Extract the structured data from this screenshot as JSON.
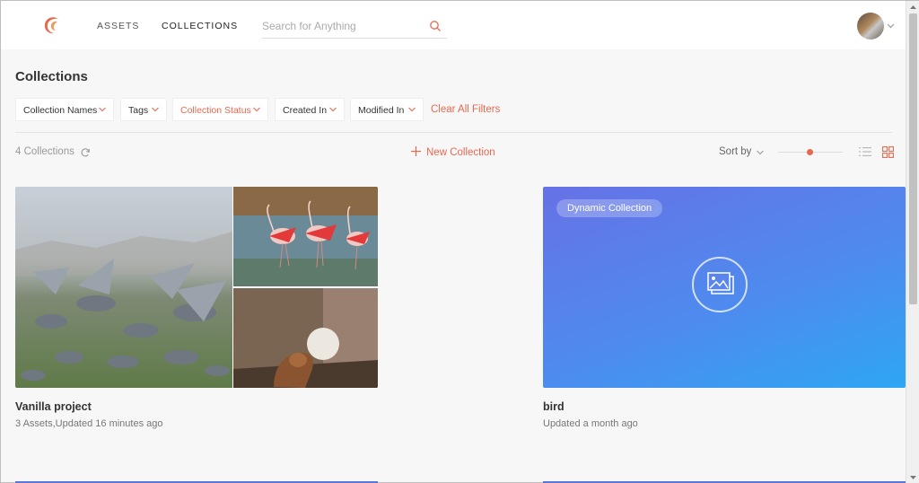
{
  "nav": {
    "assets": "ASSETS",
    "collections": "COLLECTIONS",
    "search_placeholder": "Search for Anything"
  },
  "page": {
    "title": "Collections",
    "filters": [
      {
        "label": "Collection Names"
      },
      {
        "label": "Tags"
      },
      {
        "label": "Collection Status"
      },
      {
        "label": "Created In"
      },
      {
        "label": "Modified In"
      }
    ],
    "clear_filters": "Clear All Filters",
    "count": "4 Collections",
    "new_collection": "New Collection",
    "sort_by": "Sort by"
  },
  "collections": [
    {
      "title": "Vanilla project",
      "subtitle": "3 Assets,Updated 16 minutes ago"
    },
    {
      "title": "bird",
      "subtitle": "Updated a month ago",
      "badge": "Dynamic Collection"
    }
  ],
  "colors": {
    "accent": "#e8684f",
    "card_gradient_start": "#6672e6",
    "card_gradient_end": "#2ea6f3"
  },
  "icons": {
    "logo": "brand-logo-icon",
    "search": "search-icon",
    "refresh": "refresh-icon",
    "plus": "plus-icon",
    "list_view": "list-view-icon",
    "grid_view": "grid-view-icon",
    "image": "image-icon"
  }
}
